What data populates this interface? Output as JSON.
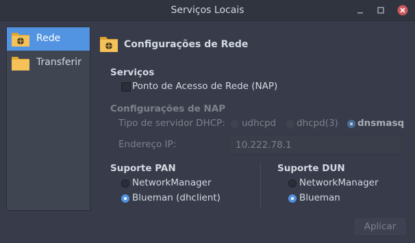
{
  "window": {
    "title": "Serviços Locais"
  },
  "sidebar": {
    "items": [
      {
        "label": "Rede",
        "icon": "network-folder-icon",
        "selected": true
      },
      {
        "label": "Transferir",
        "icon": "folder-icon",
        "selected": false
      }
    ]
  },
  "main": {
    "header": "Configurações de Rede",
    "servicos": {
      "title": "Serviços",
      "nap_checkbox": {
        "label": "Ponto de Acesso de Rede (NAP)",
        "checked": false
      }
    },
    "nap": {
      "title": "Configurações de NAP",
      "dhcp_label": "Tipo de servidor DHCP:",
      "dhcp_options": [
        {
          "label": "udhcpd",
          "selected": false
        },
        {
          "label": "dhcpd(3)",
          "selected": false
        },
        {
          "label": "dnsmasq",
          "selected": true
        }
      ],
      "ip_label": "Endereço IP:",
      "ip_value": "10.222.78.1"
    },
    "pan": {
      "title": "Suporte PAN",
      "options": [
        {
          "label": "NetworkManager",
          "selected": false
        },
        {
          "label": "Blueman (dhclient)",
          "selected": true
        }
      ]
    },
    "dun": {
      "title": "Suporte DUN",
      "options": [
        {
          "label": "NetworkManager",
          "selected": false
        },
        {
          "label": "Blueman",
          "selected": true
        }
      ]
    },
    "apply_label": "Aplicar"
  },
  "colors": {
    "accent": "#5294e2",
    "background": "#383c4a",
    "titlebar": "#2f343f",
    "close_button": "#cc575d",
    "folder": "#f5c25a"
  }
}
